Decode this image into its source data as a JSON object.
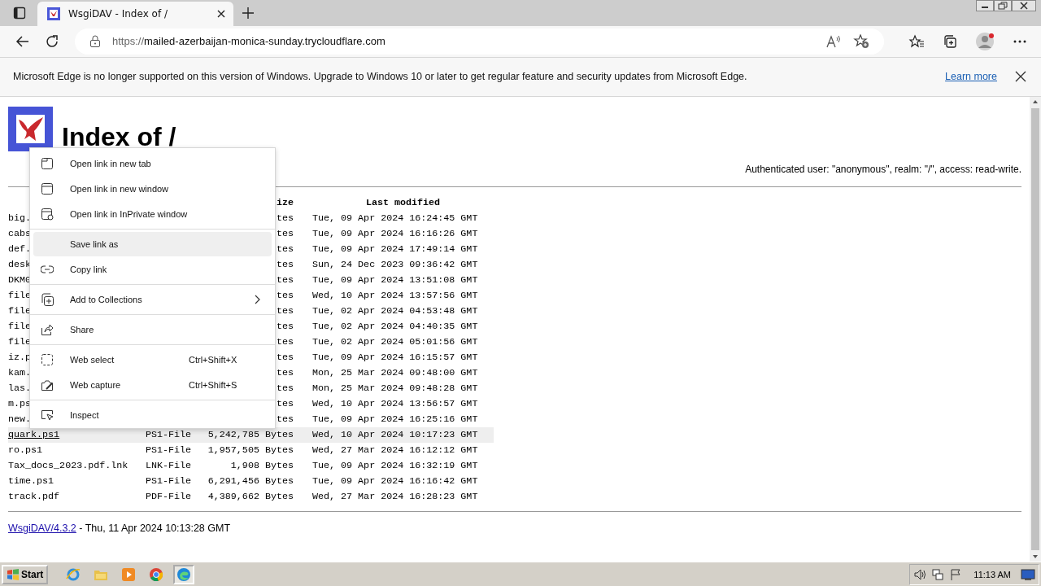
{
  "browser": {
    "tab": {
      "title": "WsgiDAV - Index of /"
    },
    "address": {
      "scheme": "https://",
      "host": "mailed-azerbaijan-monica-sunday.trycloudflare.com"
    },
    "infobar": {
      "message": "Microsoft Edge is no longer supported on this version of Windows. Upgrade to Windows 10 or later to get regular feature and security updates from Microsoft Edge.",
      "link": "Learn more"
    }
  },
  "page": {
    "title": "Index of /",
    "auth": "Authenticated user: \"anonymous\", realm: \"/\", access: read-write.",
    "table": {
      "columns": [
        "",
        "",
        "ize",
        "Last modified"
      ],
      "rows": [
        {
          "name": "big.",
          "type": "",
          "size": "tes",
          "modified": "Tue, 09 Apr 2024 16:24:45 GMT",
          "hovered": false
        },
        {
          "name": "cabs",
          "type": "",
          "size": "tes",
          "modified": "Tue, 09 Apr 2024 16:16:26 GMT",
          "hovered": false
        },
        {
          "name": "def.",
          "type": "",
          "size": "tes",
          "modified": "Tue, 09 Apr 2024 17:49:14 GMT",
          "hovered": false
        },
        {
          "name": "desk",
          "type": "",
          "size": "tes",
          "modified": "Sun, 24 Dec 2023 09:36:42 GMT",
          "hovered": false
        },
        {
          "name": "DKM0",
          "type": "",
          "size": "tes",
          "modified": "Tue, 09 Apr 2024 13:51:08 GMT",
          "hovered": false
        },
        {
          "name": "file",
          "type": "",
          "size": "tes",
          "modified": "Wed, 10 Apr 2024 13:57:56 GMT",
          "hovered": false
        },
        {
          "name": "file",
          "type": "",
          "size": "tes",
          "modified": "Tue, 02 Apr 2024 04:53:48 GMT",
          "hovered": false
        },
        {
          "name": "file",
          "type": "",
          "size": "tes",
          "modified": "Tue, 02 Apr 2024 04:40:35 GMT",
          "hovered": false
        },
        {
          "name": "file",
          "type": "",
          "size": "tes",
          "modified": "Tue, 02 Apr 2024 05:01:56 GMT",
          "hovered": false
        },
        {
          "name": "iz.p",
          "type": "",
          "size": "tes",
          "modified": "Tue, 09 Apr 2024 16:15:57 GMT",
          "hovered": false
        },
        {
          "name": "kam.",
          "type": "",
          "size": "tes",
          "modified": "Mon, 25 Mar 2024 09:48:00 GMT",
          "hovered": false
        },
        {
          "name": "las.",
          "type": "",
          "size": "tes",
          "modified": "Mon, 25 Mar 2024 09:48:28 GMT",
          "hovered": false
        },
        {
          "name": "m.ps",
          "type": "",
          "size": "tes",
          "modified": "Wed, 10 Apr 2024 13:56:57 GMT",
          "hovered": false
        },
        {
          "name": "new.",
          "type": "",
          "size": "tes",
          "modified": "Tue, 09 Apr 2024 16:25:16 GMT",
          "hovered": false
        },
        {
          "name": "quark.ps1",
          "type": "PS1-File",
          "size": "5,242,785 Bytes",
          "modified": "Wed, 10 Apr 2024 10:17:23 GMT",
          "hovered": true
        },
        {
          "name": "ro.ps1",
          "type": "PS1-File",
          "size": "1,957,505 Bytes",
          "modified": "Wed, 27 Mar 2024 16:12:12 GMT",
          "hovered": false
        },
        {
          "name": "Tax_docs_2023.pdf.lnk",
          "type": "LNK-File",
          "size": "1,908 Bytes",
          "modified": "Tue, 09 Apr 2024 16:32:19 GMT",
          "hovered": false
        },
        {
          "name": "time.ps1",
          "type": "PS1-File",
          "size": "6,291,456 Bytes",
          "modified": "Tue, 09 Apr 2024 16:16:42 GMT",
          "hovered": false
        },
        {
          "name": "track.pdf",
          "type": "PDF-File",
          "size": "4,389,662 Bytes",
          "modified": "Wed, 27 Mar 2024 16:28:23 GMT",
          "hovered": false
        }
      ]
    },
    "footer": {
      "link": "WsgiDAV/4.3.2",
      "text": " - Thu, 11 Apr 2024 10:13:28 GMT"
    }
  },
  "context_menu": {
    "groups": [
      [
        {
          "label": "Open link in new tab",
          "hovered": false,
          "submenu": false
        },
        {
          "label": "Open link in new window",
          "hovered": false,
          "submenu": false
        },
        {
          "label": "Open link in InPrivate window",
          "hovered": false,
          "submenu": false
        }
      ],
      [
        {
          "label": "Save link as",
          "hovered": true,
          "submenu": false
        },
        {
          "label": "Copy link",
          "hovered": false,
          "submenu": false
        }
      ],
      [
        {
          "label": "Add to Collections",
          "hovered": false,
          "submenu": true
        }
      ],
      [
        {
          "label": "Share",
          "hovered": false,
          "submenu": false
        }
      ],
      [
        {
          "label": "Web select",
          "shortcut": "Ctrl+Shift+X",
          "hovered": false,
          "submenu": false
        },
        {
          "label": "Web capture",
          "shortcut": "Ctrl+Shift+S",
          "hovered": false,
          "submenu": false
        }
      ],
      [
        {
          "label": "Inspect",
          "hovered": false,
          "submenu": false
        }
      ]
    ]
  },
  "taskbar": {
    "start": "Start",
    "clock": "11:13 AM"
  }
}
